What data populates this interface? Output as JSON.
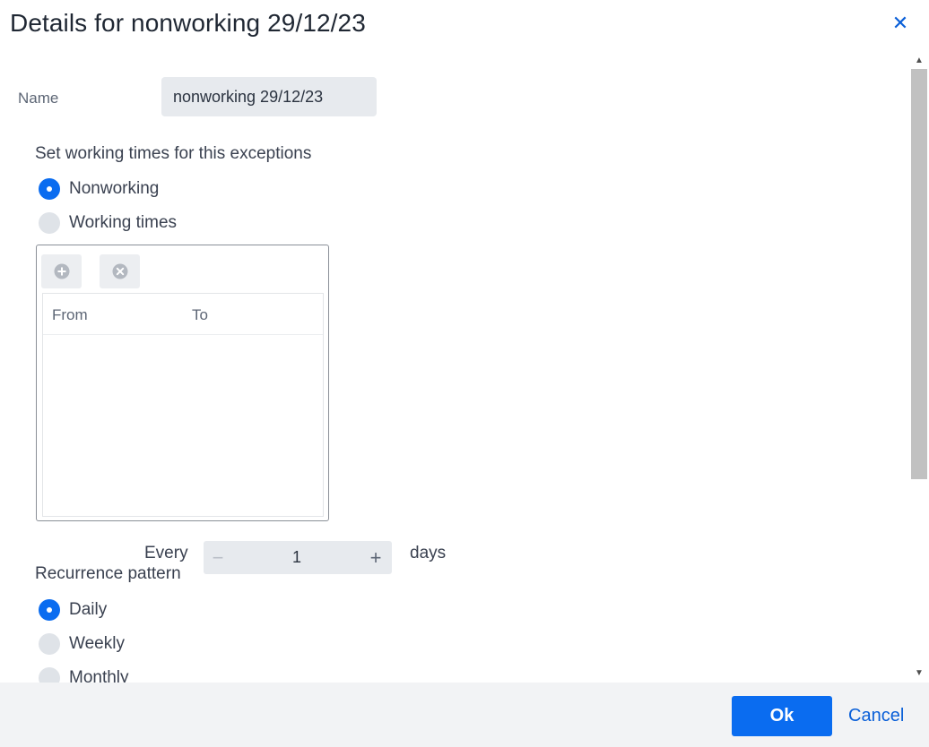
{
  "dialog": {
    "title": "Details for nonworking 29/12/23",
    "close_icon": "close-icon"
  },
  "name": {
    "label": "Name",
    "value": "nonworking 29/12/23"
  },
  "working_times": {
    "section_label": "Set working times for this exceptions",
    "options": [
      {
        "label": "Nonworking",
        "checked": true
      },
      {
        "label": "Working times",
        "checked": false
      }
    ],
    "toolbar": {
      "add_icon": "add-circle-icon",
      "remove_icon": "remove-circle-icon"
    },
    "columns": [
      "From",
      "To"
    ]
  },
  "recurrence": {
    "section_label": "Recurrence pattern",
    "options": [
      {
        "label": "Daily",
        "checked": true
      },
      {
        "label": "Weekly",
        "checked": false
      },
      {
        "label": "Monthly",
        "checked": false
      }
    ],
    "every_label": "Every",
    "every_value": "1",
    "unit_label": "days",
    "minus_symbol": "−",
    "plus_symbol": "+"
  },
  "footer": {
    "ok_label": "Ok",
    "cancel_label": "Cancel"
  },
  "colors": {
    "accent": "#0a6cf0",
    "link": "#0a5fd8"
  }
}
